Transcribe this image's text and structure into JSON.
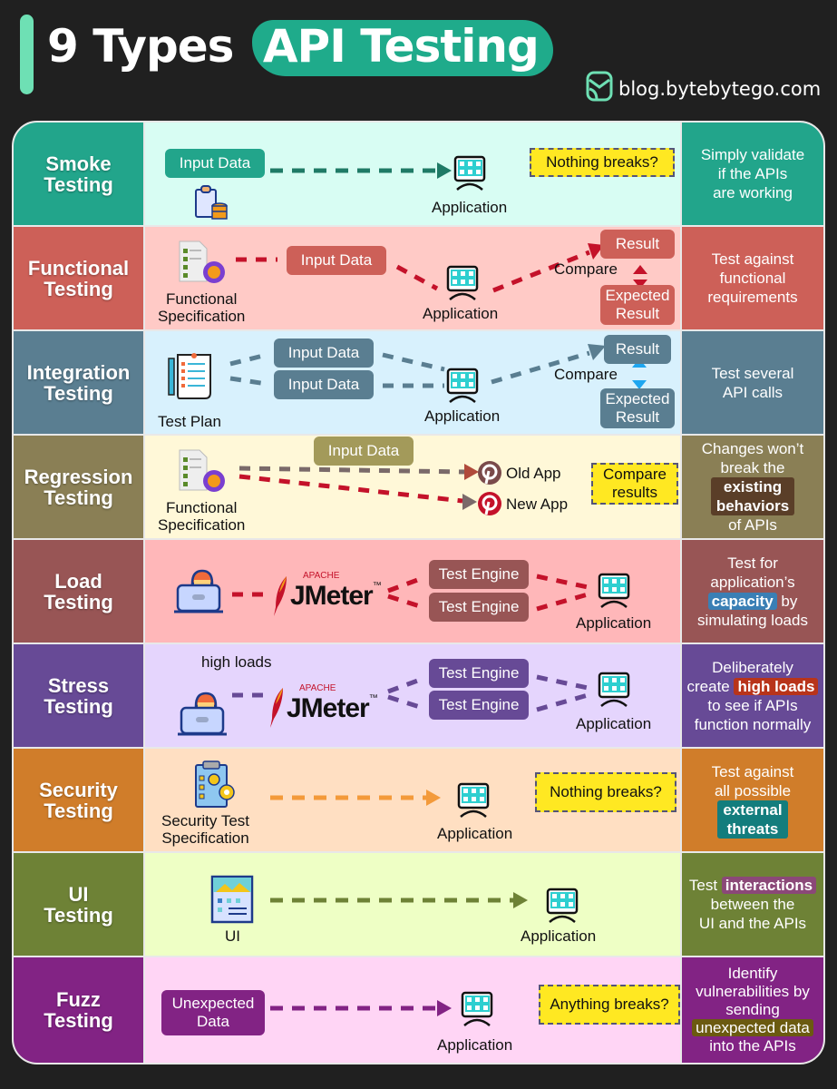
{
  "header": {
    "title_prefix": "9 Types",
    "title_highlight": "API Testing",
    "brand": "blog.bytebytego.com"
  },
  "colors": {
    "accent_bar": "#6ee0b4",
    "title_highlight": "#1fab8b",
    "note_yellow": "#ffe822"
  },
  "rows": [
    {
      "label": [
        "Smoke",
        "Testing"
      ],
      "label_color": "#22a58b",
      "bg": "#d8fdf3",
      "flow_color": "#1f7a66",
      "items": {
        "input": "Input Data",
        "app": "Application",
        "note": "Nothing breaks?"
      },
      "icons": [
        "clipboard-database-icon",
        "application-icon"
      ],
      "desc": [
        "Simply validate",
        "if the APIs",
        "are working"
      ]
    },
    {
      "label": [
        "Functional",
        "Testing"
      ],
      "label_color": "#cd6058",
      "bg": "#ffcac6",
      "flow_color": "#c4122a",
      "items": {
        "spec": [
          "Functional",
          "Specification"
        ],
        "input": "Input Data",
        "app": "Application",
        "compare": "Compare",
        "result": "Result",
        "expected": [
          "Expected",
          "Result"
        ]
      },
      "icons": [
        "functional-spec-icon",
        "application-icon"
      ],
      "desc": [
        "Test against",
        "functional",
        "requirements"
      ]
    },
    {
      "label": [
        "Integration",
        "Testing"
      ],
      "label_color": "#5a7e91",
      "bg": "#d8f1fd",
      "flow_color": "#5a7e91",
      "items": {
        "plan": "Test Plan",
        "input1": "Input Data",
        "input2": "Input Data",
        "app": "Application",
        "compare": "Compare",
        "result": "Result",
        "expected": [
          "Expected",
          "Result"
        ]
      },
      "icons": [
        "test-plan-icon",
        "application-icon"
      ],
      "desc": [
        "Test several",
        "API calls"
      ]
    },
    {
      "label": [
        "Regression",
        "Testing"
      ],
      "label_color": "#8a7f55",
      "bg": "#fff8d8",
      "flow_color": "#7a6a6a",
      "items": {
        "spec": [
          "Functional",
          "Specification"
        ],
        "input": "Input Data",
        "old_app": "Old App",
        "new_app": "New App",
        "note": [
          "Compare",
          "results"
        ]
      },
      "icons": [
        "functional-spec-icon",
        "old-app-icon",
        "new-app-icon"
      ],
      "desc": {
        "before": [
          "Changes won’t",
          "break the"
        ],
        "chip": [
          "existing",
          "behaviors"
        ],
        "after": "of APIs",
        "chip_color": "#5a3e28"
      }
    },
    {
      "label": [
        "Load",
        "Testing"
      ],
      "label_color": "#985555",
      "bg": "#ffb7b9",
      "flow_color": "#c4122a",
      "items": {
        "tool_top": "APACHE",
        "tool": "JMeter",
        "tm": "™",
        "engine1": "Test Engine",
        "engine2": "Test Engine",
        "app": "Application"
      },
      "icons": [
        "user-laptop-icon",
        "apache-feather-icon",
        "application-icon"
      ],
      "desc": {
        "before": [
          "Test for",
          "application’s"
        ],
        "chip": "capacity",
        "chip_after": " by",
        "after": "simulating loads",
        "chip_color": "#3a7fb5"
      }
    },
    {
      "label": [
        "Stress",
        "Testing"
      ],
      "label_color": "#674a96",
      "bg": "#e5d5fd",
      "flow_color": "#674a96",
      "items": {
        "caption": "high loads",
        "tool_top": "APACHE",
        "tool": "JMeter",
        "tm": "™",
        "engine1": "Test Engine",
        "engine2": "Test Engine",
        "app": "Application"
      },
      "icons": [
        "user-laptop-icon",
        "apache-feather-icon",
        "application-icon"
      ],
      "desc": {
        "before": "Deliberately",
        "chip_before": "create ",
        "chip": "high loads",
        "after": [
          "to see if APIs",
          "function normally"
        ],
        "chip_color": "#b8341a"
      }
    },
    {
      "label": [
        "Security",
        "Testing"
      ],
      "label_color": "#d07d2a",
      "bg": "#ffdfc2",
      "flow_color": "#f39a3a",
      "items": {
        "spec": [
          "Security Test",
          "Specification"
        ],
        "app": "Application",
        "note": "Nothing breaks?"
      },
      "icons": [
        "security-spec-icon",
        "application-icon"
      ],
      "desc": {
        "before": [
          "Test against",
          "all possible"
        ],
        "chip": [
          "external",
          "threats"
        ],
        "chip_color": "#137d7d"
      }
    },
    {
      "label": [
        "UI",
        "Testing"
      ],
      "label_color": "#6e8236",
      "bg": "#eeffc5",
      "flow_color": "#6e8236",
      "items": {
        "ui": "UI",
        "app": "Application"
      },
      "icons": [
        "ui-window-icon",
        "application-icon"
      ],
      "desc": {
        "chip_before": "Test ",
        "chip": "interactions",
        "after": [
          "between the",
          "UI and the APIs"
        ],
        "chip_color": "#8b4878"
      }
    },
    {
      "label": [
        "Fuzz",
        "Testing"
      ],
      "label_color": "#822384",
      "bg": "#ffd5f5",
      "flow_color": "#822384",
      "items": {
        "input": [
          "Unexpected",
          "Data"
        ],
        "app": "Application",
        "note": "Anything breaks?"
      },
      "icons": [
        "application-icon"
      ],
      "desc": {
        "before": [
          "Identify",
          "vulnerabilities by",
          "sending"
        ],
        "chip": "unexpected data",
        "after": "into the APIs",
        "chip_color": "#6b5a10"
      }
    }
  ]
}
